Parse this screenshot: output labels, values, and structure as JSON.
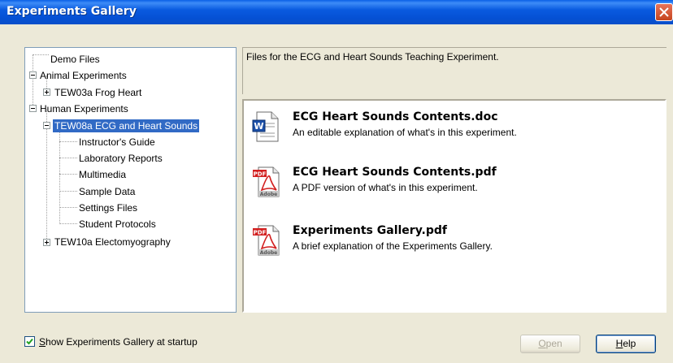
{
  "window": {
    "title": "Experiments Gallery"
  },
  "tree": {
    "demo_files": "Demo Files",
    "animal_experiments": "Animal Experiments",
    "frog_heart": "TEW03a Frog Heart",
    "human_experiments": "Human Experiments",
    "ecg_heart_sounds": "TEW08a ECG and Heart Sounds",
    "children": [
      "Instructor's Guide",
      "Laboratory Reports",
      "Multimedia",
      "Sample Data",
      "Settings Files",
      "Student Protocols"
    ],
    "electromyography": "TEW10a Electomyography"
  },
  "description": "Files for the ECG and Heart Sounds Teaching Experiment.",
  "files": [
    {
      "name": "ECG Heart Sounds Contents.doc",
      "desc": "An editable explanation of what's in this experiment.",
      "icon": "word-doc-icon"
    },
    {
      "name": "ECG Heart Sounds Contents.pdf",
      "desc": "A PDF version of what's in this experiment.",
      "icon": "pdf-icon"
    },
    {
      "name": "Experiments Gallery.pdf",
      "desc": "A brief explanation of the Experiments Gallery.",
      "icon": "pdf-icon"
    }
  ],
  "startup": {
    "label_accel": "S",
    "label_rest": "how Experiments Gallery at startup",
    "checked": true
  },
  "buttons": {
    "open_accel": "O",
    "open_rest": "pen",
    "help_accel": "H",
    "help_rest": "elp"
  }
}
